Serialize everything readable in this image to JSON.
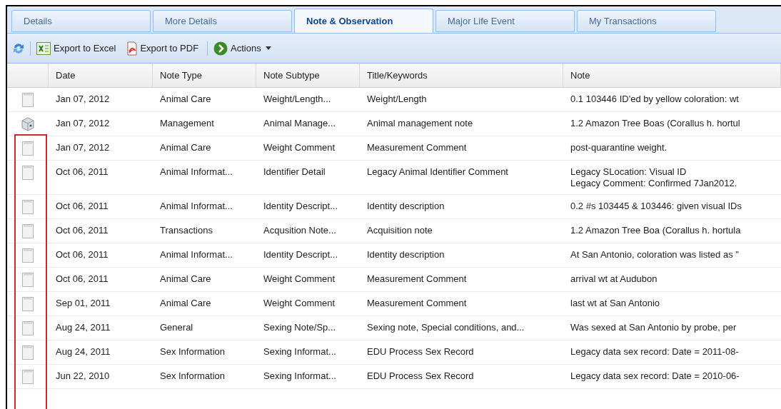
{
  "tabs": [
    {
      "label": "Details",
      "selected": false
    },
    {
      "label": "More Details",
      "selected": false
    },
    {
      "label": "Note & Observation",
      "selected": true
    },
    {
      "label": "Major Life Event",
      "selected": false
    },
    {
      "label": "My Transactions",
      "selected": false
    }
  ],
  "toolbar": {
    "export_excel": "Export to Excel",
    "export_pdf": "Export to PDF",
    "actions": "Actions"
  },
  "table": {
    "columns": [
      "Date",
      "Note Type",
      "Note Subtype",
      "Title/Keywords",
      "Note"
    ],
    "rows": [
      {
        "kind": "note",
        "cells": [
          "Jan 07, 2012",
          "Animal Care",
          "Weight/Length...",
          "Weight/Length",
          "0.1 103446 ID'ed by yellow coloration: wt"
        ]
      },
      {
        "kind": "management",
        "cells": [
          "Jan 07, 2012",
          "Management",
          "Animal Manage...",
          "Animal management note",
          "1.2 Amazon Tree Boas (Corallus h. hortul"
        ]
      },
      {
        "kind": "note",
        "cells": [
          "Jan 07, 2012",
          "Animal Care",
          "Weight Comment",
          "Measurement Comment",
          "post-quarantine weight."
        ]
      },
      {
        "kind": "note",
        "cells": [
          "Oct 06, 2011",
          "Animal Informat...",
          "Identifier Detail",
          "Legacy Animal Identifier Comment",
          "Legacy SLocation: Visual ID\nLegacy Comment: Confirmed 7Jan2012."
        ]
      },
      {
        "kind": "note",
        "cells": [
          "Oct 06, 2011",
          "Animal Informat...",
          "Identity Descript...",
          "Identity description",
          "0.2 #s 103445 & 103446: given visual IDs"
        ]
      },
      {
        "kind": "note",
        "cells": [
          "Oct 06, 2011",
          "Transactions",
          "Acqusition Note...",
          "Acquisition note",
          "1.2 Amazon Tree Boa (Corallus h. hortula"
        ]
      },
      {
        "kind": "note",
        "cells": [
          "Oct 06, 2011",
          "Animal Informat...",
          "Identity Descript...",
          "Identity description",
          "At San Antonio, coloration was listed as \""
        ]
      },
      {
        "kind": "note",
        "cells": [
          "Oct 06, 2011",
          "Animal Care",
          "Weight Comment",
          "Measurement Comment",
          "arrival wt at Audubon"
        ]
      },
      {
        "kind": "note",
        "cells": [
          "Sep 01, 2011",
          "Animal Care",
          "Weight Comment",
          "Measurement Comment",
          "last wt at San Antonio"
        ]
      },
      {
        "kind": "note",
        "cells": [
          "Aug 24, 2011",
          "General",
          "Sexing Note/Sp...",
          "Sexing note, Special conditions, and...",
          "Was sexed at San Antonio by probe, per"
        ]
      },
      {
        "kind": "note",
        "cells": [
          "Aug 24, 2011",
          "Sex Information",
          "Sexing Informat...",
          "EDU Process Sex Record",
          "Legacy data sex record: Date = 2011-08-"
        ]
      },
      {
        "kind": "note",
        "cells": [
          "Jun 22, 2010",
          "Sex Information",
          "Sexing Informat...",
          "EDU Process Sex Record",
          "Legacy data sex record: Date = 2010-06-"
        ]
      }
    ]
  }
}
